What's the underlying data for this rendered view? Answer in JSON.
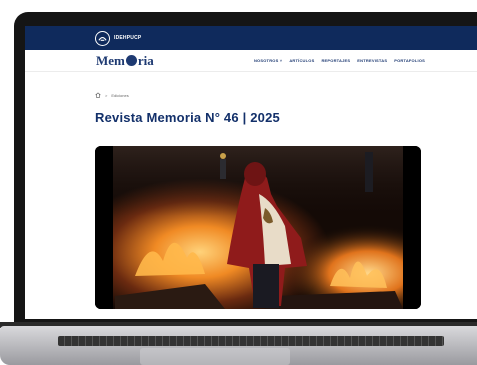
{
  "site": {
    "institution": "IDEHPUCP",
    "brand": {
      "prefix": "Mem",
      "suffix": "ria"
    }
  },
  "nav": {
    "items": [
      "NOSOTROS ˅",
      "ARTÍCULOS",
      "REPORTAJES",
      "ENTREVISTAS",
      "PORTAFOLIOS"
    ]
  },
  "breadcrumb": {
    "separator": ">",
    "current": "Ediciones"
  },
  "page": {
    "title": "Revista Memoria N° 46 | 2025"
  },
  "colors": {
    "topbar": "#0f2a5c",
    "brand": "#1e3a72",
    "title": "#13306a"
  },
  "icons": {
    "home": "home-icon",
    "logo": "idehpucp-logo-icon"
  }
}
